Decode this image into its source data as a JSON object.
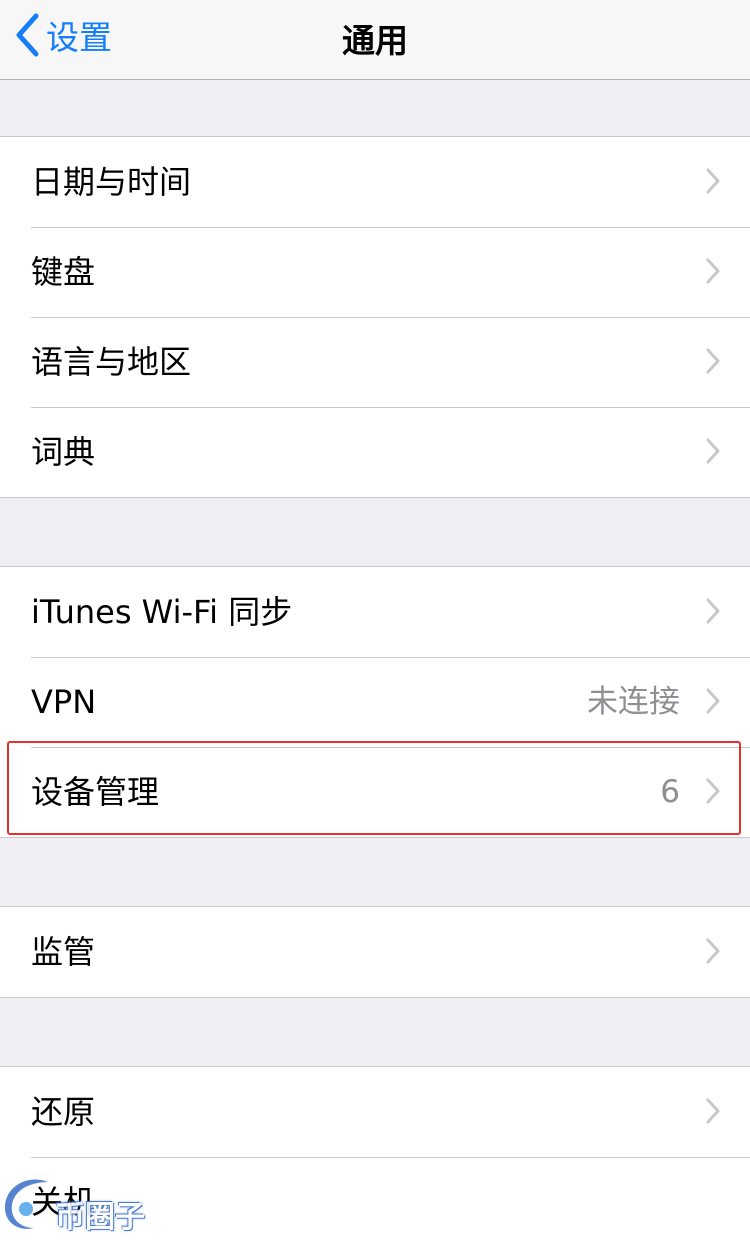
{
  "navbar": {
    "back_label": "设置",
    "title": "通用"
  },
  "groups": [
    {
      "items": [
        {
          "label": "日期与时间"
        },
        {
          "label": "键盘"
        },
        {
          "label": "语言与地区"
        },
        {
          "label": "词典"
        }
      ]
    },
    {
      "items": [
        {
          "label": "iTunes Wi-Fi 同步"
        },
        {
          "label": "VPN",
          "detail": "未连接"
        },
        {
          "label": "设备管理",
          "detail": "6"
        }
      ]
    },
    {
      "items": [
        {
          "label": "监管"
        }
      ]
    },
    {
      "items": [
        {
          "label": "还原"
        },
        {
          "label": "关机"
        }
      ]
    }
  ],
  "watermark": {
    "text": "币圈子"
  },
  "colors": {
    "accent": "#157efb",
    "highlight": "#e5312c",
    "background": "#efeff4"
  }
}
